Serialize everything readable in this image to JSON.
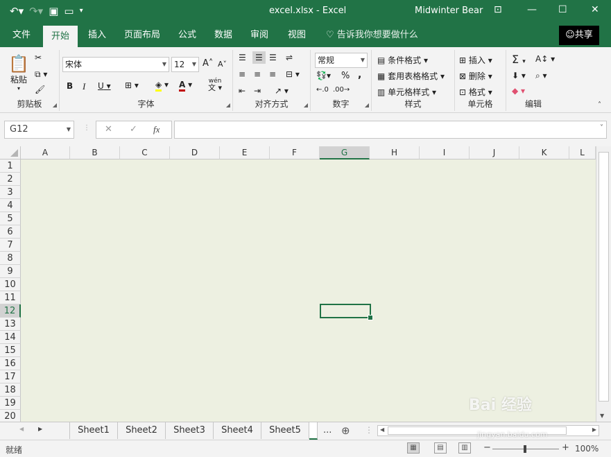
{
  "window": {
    "title": "excel.xlsx  -  Excel",
    "user": "Midwinter Bear",
    "qat_icons": [
      "undo-icon",
      "redo-icon",
      "save-icon",
      "open-icon",
      "customize-qat-icon"
    ],
    "controls": {
      "ribbon_display": "⊡",
      "minimize": "—",
      "maximize": "☐",
      "close": "✕"
    }
  },
  "tabs": [
    {
      "label": "文件"
    },
    {
      "label": "开始",
      "active": true
    },
    {
      "label": "插入"
    },
    {
      "label": "页面布局"
    },
    {
      "label": "公式"
    },
    {
      "label": "数据"
    },
    {
      "label": "审阅"
    },
    {
      "label": "视图"
    }
  ],
  "tell_me": "告诉我你想要做什么",
  "share_label": "共享",
  "ribbon": {
    "clipboard": {
      "label": "剪贴板",
      "paste": "粘贴"
    },
    "font": {
      "label": "字体",
      "font_name": "宋体",
      "font_size": "12",
      "bold": "B",
      "italic": "I",
      "underline": "U",
      "phonetic": "wén"
    },
    "alignment": {
      "label": "对齐方式"
    },
    "number": {
      "label": "数字",
      "format": "常规",
      "percent": "%",
      "comma": ","
    },
    "styles": {
      "label": "样式",
      "conditional": "条件格式",
      "table": "套用表格格式",
      "cell_styles": "单元格样式"
    },
    "cells": {
      "label": "单元格",
      "insert": "插入",
      "delete": "删除",
      "format": "格式"
    },
    "editing": {
      "label": "编辑"
    }
  },
  "formula_bar": {
    "name_box": "G12",
    "fx": "fx",
    "cancel": "✕",
    "enter": "✓",
    "value": ""
  },
  "columns": [
    "A",
    "B",
    "C",
    "D",
    "E",
    "F",
    "G",
    "H",
    "I",
    "J",
    "K",
    "L"
  ],
  "rows": [
    "1",
    "2",
    "3",
    "4",
    "5",
    "6",
    "7",
    "8",
    "9",
    "10",
    "11",
    "12",
    "13",
    "14",
    "15",
    "16",
    "17",
    "18",
    "19",
    "20"
  ],
  "selected": {
    "cell": "G12",
    "column": "G",
    "row": "12"
  },
  "sheets": [
    "Sheet1",
    "Sheet2",
    "Sheet3",
    "Sheet4",
    "Sheet5"
  ],
  "active_sheet": "Sheet5",
  "more_sheets": "...",
  "status": {
    "ready": "就绪",
    "zoom": "100%"
  },
  "watermark": {
    "main": "Bai 经验",
    "sub": "jingyan.baidu.com"
  },
  "colors": {
    "accent": "#217346",
    "grid_fill": "#edf0e1"
  }
}
